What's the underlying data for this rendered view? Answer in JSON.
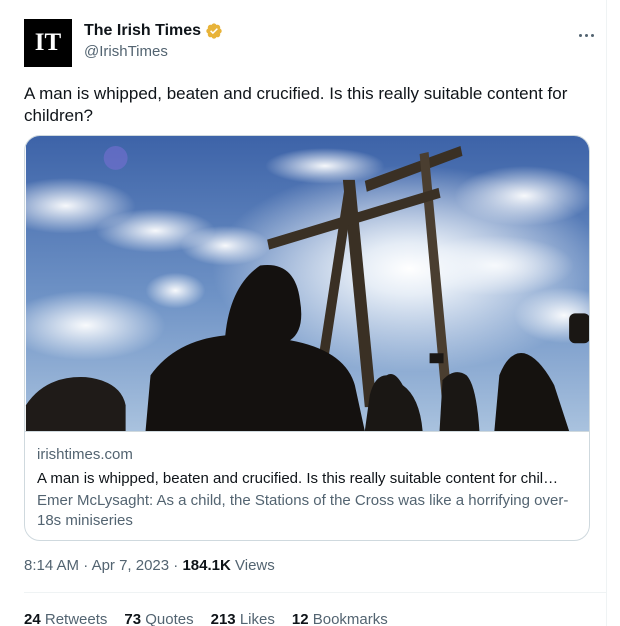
{
  "account": {
    "logo_text": "IT",
    "display_name": "The Irish Times",
    "handle": "@IrishTimes",
    "verified_color": "#e8b339"
  },
  "tweet": {
    "text": "A man is whipped, beaten and crucified. Is this really suitable content for children?"
  },
  "card": {
    "domain": "irishtimes.com",
    "title": "A man is whipped, beaten and crucified. Is this really suitable content for chil…",
    "description": "Emer McLysaght: As a child, the Stations of the Cross was like a horrifying over-18s miniseries"
  },
  "meta": {
    "time": "8:14 AM",
    "date": "Apr 7, 2023",
    "views_count": "184.1K",
    "views_label": "Views"
  },
  "stats": [
    {
      "count": "24",
      "label": "Retweets"
    },
    {
      "count": "73",
      "label": "Quotes"
    },
    {
      "count": "213",
      "label": "Likes"
    },
    {
      "count": "12",
      "label": "Bookmarks"
    }
  ]
}
